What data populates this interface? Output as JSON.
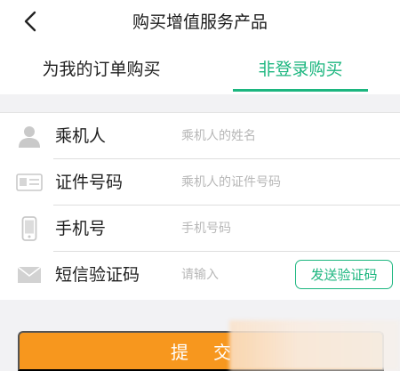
{
  "header": {
    "title": "购买增值服务产品"
  },
  "tabs": [
    {
      "label": "为我的订单购买",
      "active": false
    },
    {
      "label": "非登录购买",
      "active": true
    }
  ],
  "form": {
    "rows": [
      {
        "label": "乘机人",
        "placeholder": "乘机人的姓名",
        "value": "",
        "icon": "person-icon"
      },
      {
        "label": "证件号码",
        "placeholder": "乘机人的证件号码",
        "value": "",
        "icon": "id-card-icon"
      },
      {
        "label": "手机号",
        "placeholder": "手机号码",
        "value": "",
        "icon": "phone-icon"
      },
      {
        "label": "短信验证码",
        "placeholder": "请输入",
        "value": "",
        "icon": "envelope-icon"
      }
    ],
    "sms_button": "发送验证码"
  },
  "submit": {
    "label": "提交"
  },
  "colors": {
    "accent_green": "#1cb67f",
    "submit_orange": "#f7971e",
    "icon_gray": "#c9c9c9"
  }
}
